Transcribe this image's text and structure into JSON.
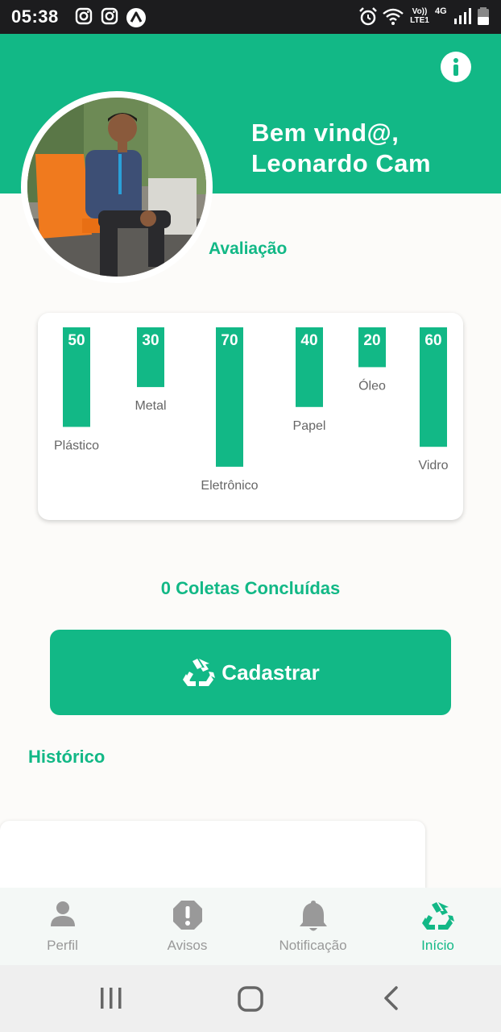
{
  "status_bar": {
    "time": "05:38",
    "network": "4G",
    "carrier": "Vo)) LTE1"
  },
  "header": {
    "welcome_line1": "Bem vind@,",
    "welcome_line2": "Leonardo Cam",
    "info_icon": "info-icon"
  },
  "rating": {
    "title": "Avaliação"
  },
  "chart_data": {
    "type": "bar",
    "categories": [
      "Plástico",
      "Metal",
      "Eletrônico",
      "Papel",
      "Óleo",
      "Vidro"
    ],
    "values": [
      50,
      30,
      70,
      40,
      20,
      60
    ],
    "color": "#12b886",
    "grid": false
  },
  "collections": {
    "text": "0 Coletas Concluídas"
  },
  "register_button": {
    "label": "Cadastrar",
    "icon": "recycle-icon"
  },
  "history": {
    "title": "Histórico"
  },
  "bottom_nav": {
    "items": [
      {
        "label": "Perfil",
        "icon": "person-icon",
        "active": false
      },
      {
        "label": "Avisos",
        "icon": "alert-octagon-icon",
        "active": false
      },
      {
        "label": "Notificação",
        "icon": "bell-icon",
        "active": false
      },
      {
        "label": "Início",
        "icon": "recycle-icon",
        "active": true
      }
    ]
  },
  "colors": {
    "accent": "#12b886",
    "background": "#fcfbf9"
  }
}
